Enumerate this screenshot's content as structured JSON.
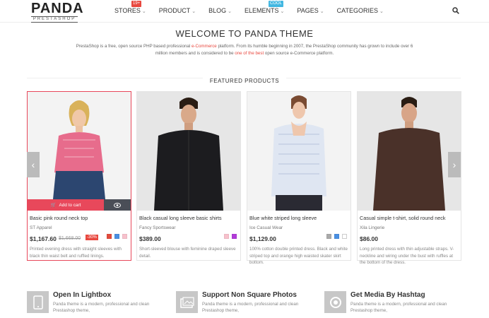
{
  "brand": {
    "name": "PANDA",
    "sub": "PRESTASHOP"
  },
  "nav": {
    "items": [
      {
        "label": "STORES",
        "badge": "19+"
      },
      {
        "label": "PRODUCT"
      },
      {
        "label": "BLOG"
      },
      {
        "label": "ELEMENTS",
        "badge": "Cool"
      },
      {
        "label": "PAGES"
      },
      {
        "label": "CATEGORIES"
      }
    ]
  },
  "welcome": {
    "title": "WELCOME TO PANDA THEME",
    "text1": "PrestaShop is a free, open source PHP based professional ",
    "link1": "e-Commerce",
    "text2": " platform. From its humble beginning in 2007, the PrestaShop community has grown to include over 6 million members and is considered to be ",
    "link2": "one of the best",
    "text3": " open source e-Commerce platform."
  },
  "featured": {
    "title": "FEATURED PRODUCTS"
  },
  "products": [
    {
      "name": "Basic pink round neck top",
      "brand": "ST Apparel",
      "price": "$1,167.60",
      "old_price": "$1,668.00",
      "discount": "-30%",
      "desc": "Printed evening dress with straight sleeves with black thin waist belt and ruffled linings.",
      "swatches": [
        "#e24b3d",
        "#4a90e2",
        "#f7c1cc"
      ],
      "add_to_cart": "Add to cart"
    },
    {
      "name": "Black casual long sleeve basic shirts",
      "brand": "Fancy Sportswear",
      "price": "$389.00",
      "desc": "Short-sleeved blouse with feminine draped sleeve detail.",
      "swatches": [
        "#f7c1cc",
        "#b23cd8"
      ]
    },
    {
      "name": "Blue white striped long sleeve",
      "brand": "Ice Casual Wear",
      "price": "$1,129.00",
      "desc": "100% cotton double printed dress. Black and white striped top and orange high waisted skater skirt bottom.",
      "swatches": [
        "#aaaaaa",
        "#4a90e2",
        "#ffffff"
      ]
    },
    {
      "name": "Casual simple t-shirt, solid round neck",
      "brand": "Xila Lingerie",
      "price": "$86.00",
      "desc": "Long printed dress with thin adjustable straps. V-neckline and wiring under the bust with ruffles at the bottom of the dress.",
      "swatches": []
    }
  ],
  "features": [
    {
      "title": "Open In Lightbox",
      "desc": "Panda theme is a modern, professional and clean Prestashop theme,",
      "icon": "phone-icon"
    },
    {
      "title": "Support Non Square Photos",
      "desc": "Panda theme is a modern, professional and clean Prestashop theme,",
      "icon": "photo-icon"
    },
    {
      "title": "Get Media By Hashtag",
      "desc": "Panda theme is a modern, professional and clean Prestashop theme,",
      "icon": "circle-icon"
    }
  ],
  "colors": {
    "accent": "#e8485b",
    "badge_red": "#e8483f",
    "badge_blue": "#42b7e1"
  }
}
